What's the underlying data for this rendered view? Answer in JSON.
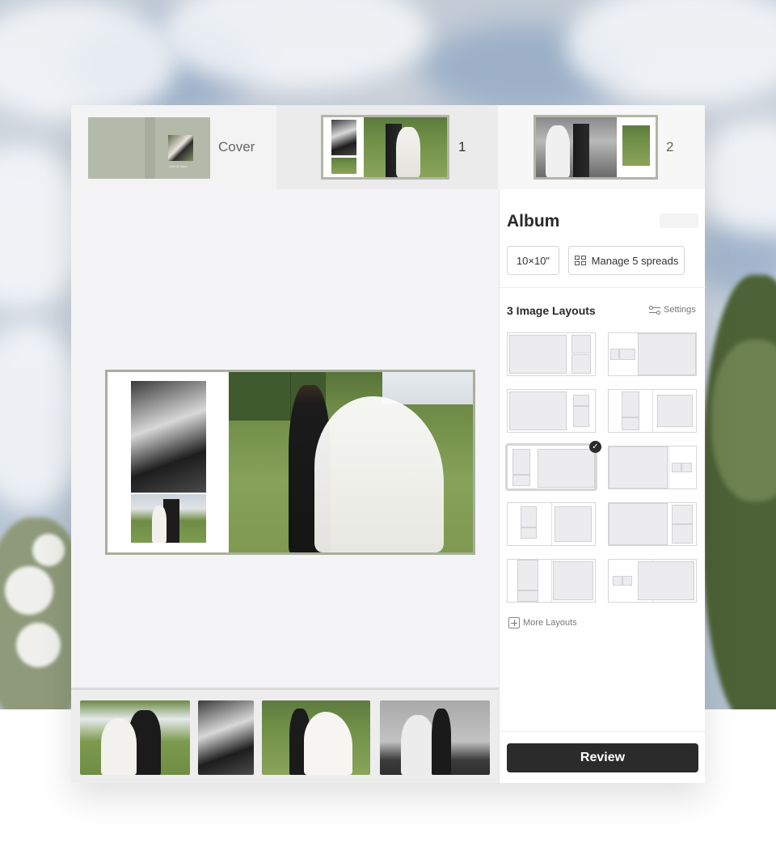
{
  "spreads_strip": {
    "cover": {
      "label": "Cover",
      "cover_title": "Cam & Maxx"
    },
    "spread_1": {
      "label": "1"
    },
    "spread_2": {
      "label": "2"
    }
  },
  "panel": {
    "title": "Album",
    "size_button": "10×10\"",
    "manage_button": "Manage 5 spreads",
    "layouts_heading": "3 Image Layouts",
    "settings_label": "Settings",
    "more_layouts_label": "More Layouts",
    "review_button": "Review",
    "selected_layout_index": 4,
    "icons": [
      "grid-icon",
      "settings-icon",
      "check-icon",
      "plus-icon"
    ]
  },
  "theme": {
    "cover_color": "#b3baa9",
    "spread_border": "#a9ae9d",
    "review_bg": "#2b2b2b"
  }
}
